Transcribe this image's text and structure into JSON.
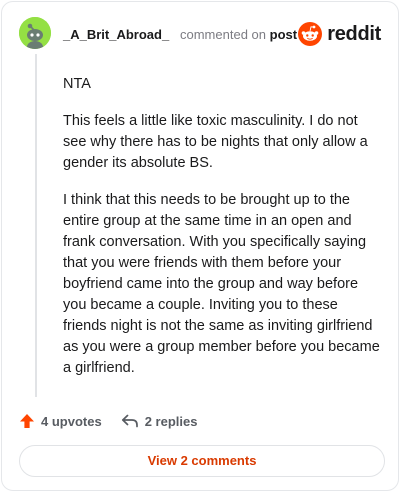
{
  "comment": {
    "username": "_A_Brit_Abroad_",
    "action_text": "commented on",
    "post_link": "post",
    "paragraphs": [
      "NTA",
      "This feels a little like toxic masculinity. I do not see why there has to be nights that only allow a gender its absolute BS.",
      "I think that this needs to be brought up to the entire group at the same time in an open and frank conversation. With you specifically saying that you were friends with them before your boyfriend came into the group and way before you became a couple. Inviting you to these friends night is not the same as inviting girlfriend as you were a group member before you became a girlfriend."
    ]
  },
  "logo": {
    "text": "reddit",
    "icon": "reddit-snoo-icon"
  },
  "actions": {
    "upvotes": "4 upvotes",
    "replies": "2 replies"
  },
  "view_comments_label": "View 2 comments",
  "colors": {
    "accent": "#d93a00",
    "avatar_bg": "#94e044",
    "upvote": "#ff4500"
  }
}
